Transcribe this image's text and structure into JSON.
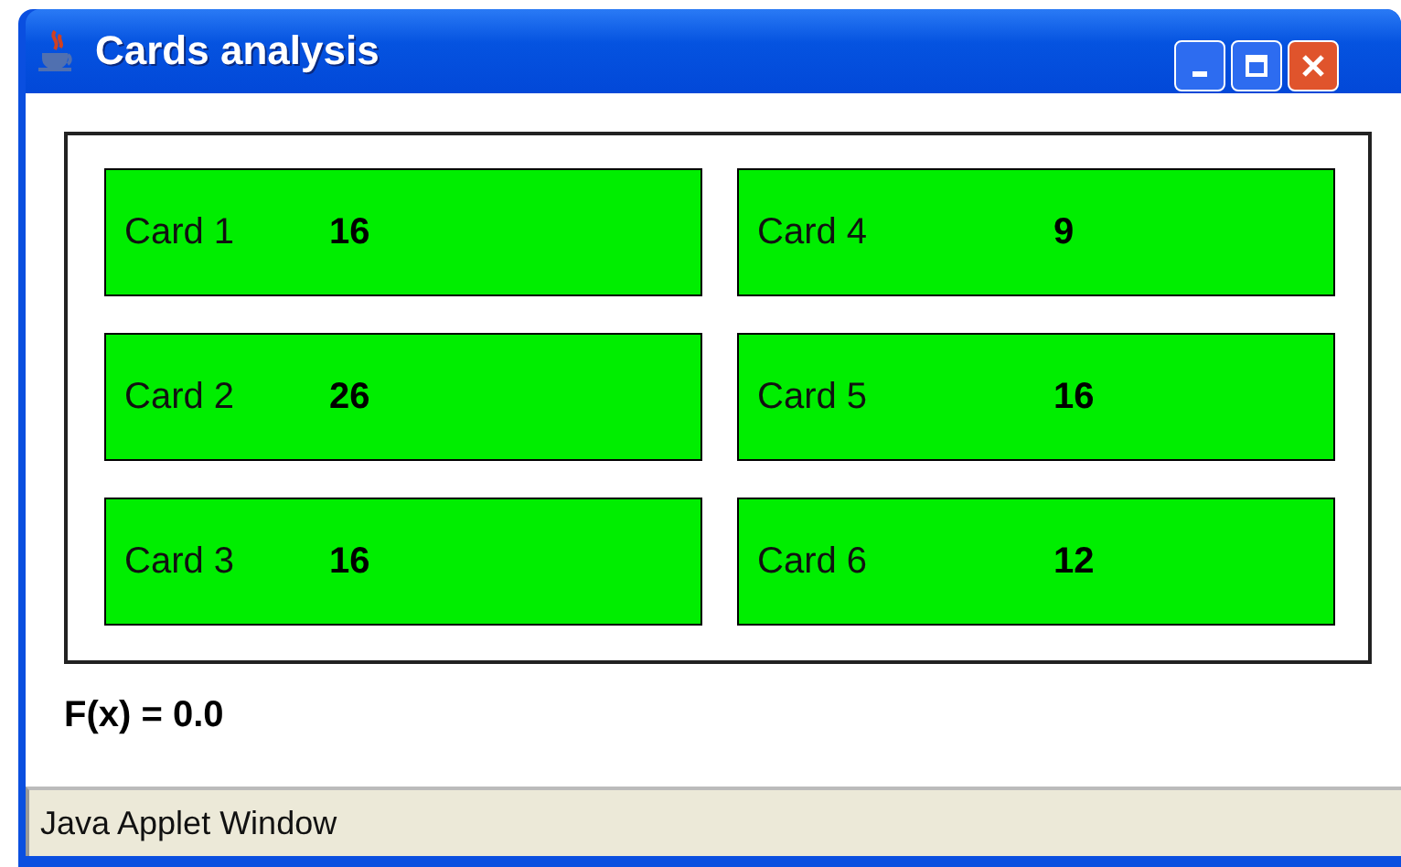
{
  "window": {
    "title": "Cards analysis"
  },
  "card_columns": [
    [
      {
        "label": "Card 1",
        "value": "16"
      },
      {
        "label": "Card 2",
        "value": "26"
      },
      {
        "label": "Card 3",
        "value": "16"
      }
    ],
    [
      {
        "label": "Card 4",
        "value": "9"
      },
      {
        "label": "Card 5",
        "value": "16"
      },
      {
        "label": "Card 6",
        "value": "12"
      }
    ]
  ],
  "result": "F(x) = 0.0",
  "status_bar": "Java Applet Window"
}
